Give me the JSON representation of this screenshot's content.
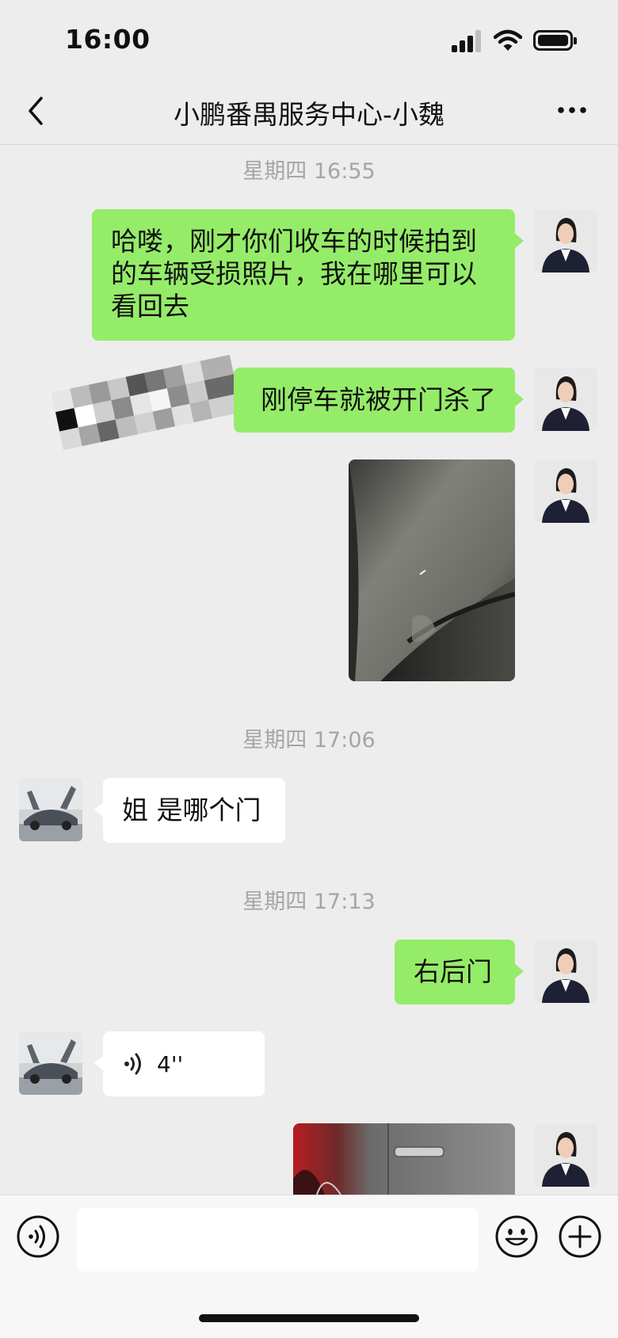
{
  "status_bar": {
    "time": "16:00"
  },
  "nav": {
    "title": "小鹏番禺服务中心-小魏",
    "back_icon": "chevron-left-icon",
    "more_icon": "more-dots-icon"
  },
  "messages": {
    "ts1": "星期四 16:55",
    "msg1": [
      "哈喽，刚才你们收车的时候拍到",
      "的车辆受损照片，我在哪里可以",
      "看回去"
    ],
    "msg2": "刚停车就被开门杀了",
    "ts2": "星期四 17:06",
    "msg3": "姐 是哪个门",
    "ts3": "星期四 17:13",
    "msg4": "右后门",
    "voice": {
      "duration": "4''",
      "icon": "voice-wave-icon"
    }
  },
  "input_bar": {
    "voice_icon": "voice-mode-icon",
    "emoji_icon": "emoji-icon",
    "plus_icon": "plus-icon"
  },
  "colors": {
    "my_bubble": "#95ec69",
    "their_bubble": "#ffffff",
    "background": "#ededed",
    "timestamp": "#a5a5a5"
  }
}
